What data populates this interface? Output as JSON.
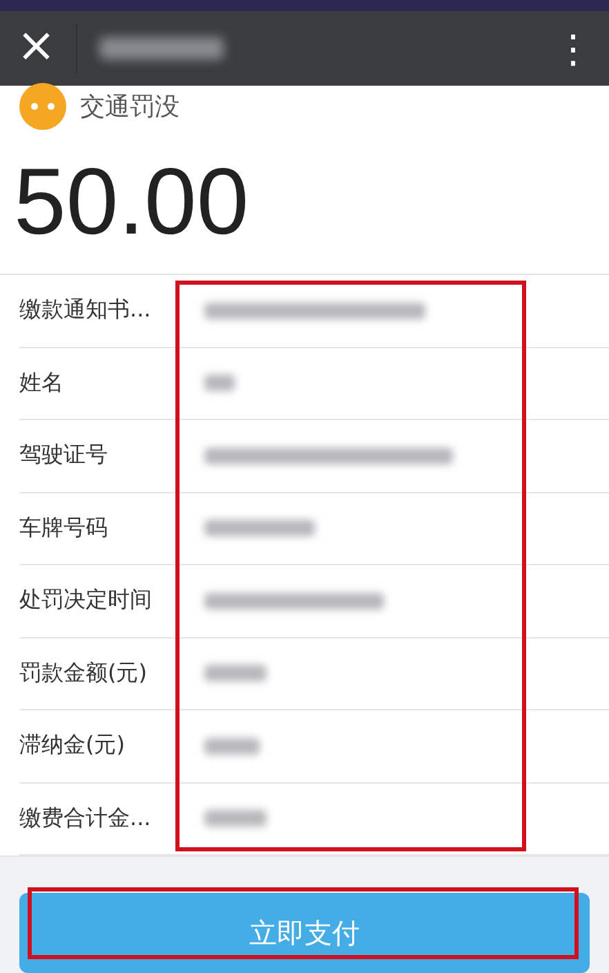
{
  "header": {
    "close": "×",
    "menu": "⋮"
  },
  "merchant": {
    "name": "交通罚没"
  },
  "amount": "50.00",
  "rows": [
    {
      "label": "缴款通知书..."
    },
    {
      "label": "姓名"
    },
    {
      "label": "驾驶证号"
    },
    {
      "label": "车牌号码"
    },
    {
      "label": "处罚决定时间"
    },
    {
      "label": "罚款金额(元)"
    },
    {
      "label": "滞纳金(元)"
    },
    {
      "label": "缴费合计金..."
    }
  ],
  "pay_button": "立即支付"
}
